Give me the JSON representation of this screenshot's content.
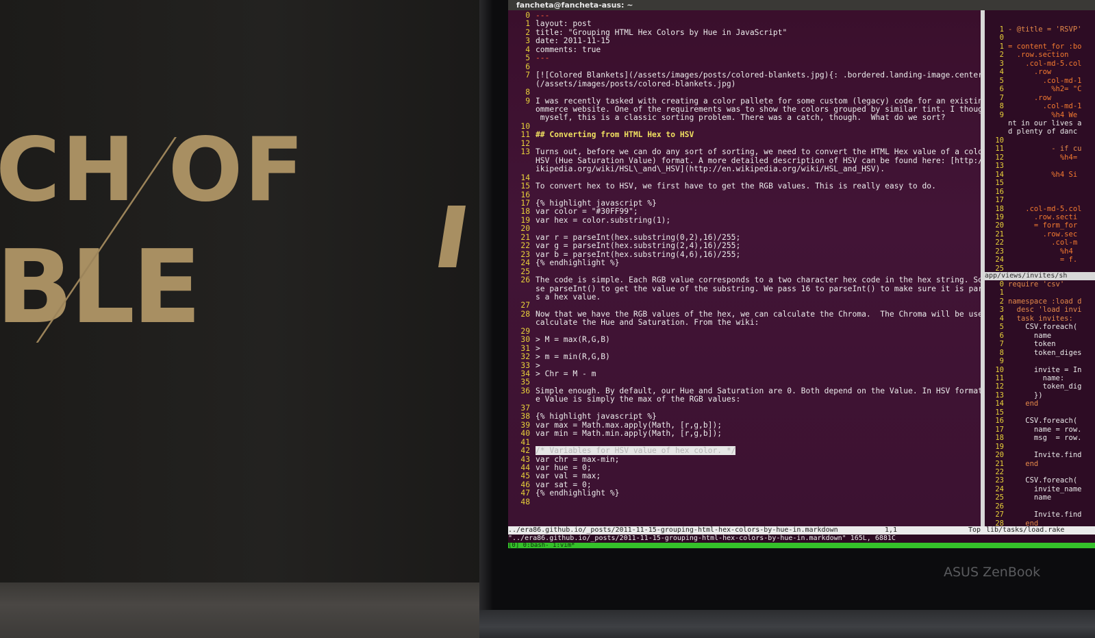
{
  "background": {
    "box_line1": "CH OF",
    "box_line2": "BLE",
    "laptop_brand": "ASUS ZenBook"
  },
  "colors": {
    "terminal_bg": "#3a0f2c",
    "line_number": "#e8d23a",
    "tmux_bar": "#35c02a",
    "heading": "#f0e060",
    "link": "#9d8cff"
  },
  "terminal": {
    "title": "fancheta@fancheta-asus: ~",
    "editor_lines": [
      {
        "n": "0",
        "t": "---"
      },
      {
        "n": "1",
        "t": "layout: post"
      },
      {
        "n": "2",
        "t": "title: \"Grouping HTML Hex Colors by Hue in JavaScript\""
      },
      {
        "n": "3",
        "t": "date: 2011-11-15"
      },
      {
        "n": "4",
        "t": "comments: true"
      },
      {
        "n": "5",
        "t": "---"
      },
      {
        "n": "6",
        "t": ""
      },
      {
        "n": "7",
        "t": "[![Colored Blankets](/assets/images/posts/colored-blankets.jpg){: .bordered.landing-image.centered }]"
      },
      {
        "n": "",
        "t": "(/assets/images/posts/colored-blankets.jpg)"
      },
      {
        "n": "8",
        "t": ""
      },
      {
        "n": "9",
        "t": "I was recently tasked with creating a color pallete for some custom (legacy) code for an existing e-c"
      },
      {
        "n": "",
        "t": "ommerce website. One of the requirements was to show the colors grouped by similar tint. I thought to"
      },
      {
        "n": "",
        "t": " myself, this is a classic sorting problem. There was a catch, though.  What do we sort?"
      },
      {
        "n": "10",
        "t": ""
      },
      {
        "n": "11",
        "t": "## Converting from HTML Hex to HSV"
      },
      {
        "n": "12",
        "t": ""
      },
      {
        "n": "13",
        "t": "Turns out, before we can do any sort of sorting, we need to convert the HTML Hex value of a color to"
      },
      {
        "n": "",
        "t": "HSV (Hue Saturation Value) format. A more detailed description of HSV can be found here: [http://en.w"
      },
      {
        "n": "",
        "t": "ikipedia.org/wiki/HSL\\_and\\_HSV](http://en.wikipedia.org/wiki/HSL_and_HSV)."
      },
      {
        "n": "14",
        "t": ""
      },
      {
        "n": "15",
        "t": "To convert hex to HSV, we first have to get the RGB values. This is really easy to do."
      },
      {
        "n": "16",
        "t": ""
      },
      {
        "n": "17",
        "t": "{% highlight javascript %}"
      },
      {
        "n": "18",
        "t": "var color = \"#30FF99\";"
      },
      {
        "n": "19",
        "t": "var hex = color.substring(1);"
      },
      {
        "n": "20",
        "t": ""
      },
      {
        "n": "21",
        "t": "var r = parseInt(hex.substring(0,2),16)/255;"
      },
      {
        "n": "22",
        "t": "var g = parseInt(hex.substring(2,4),16)/255;"
      },
      {
        "n": "23",
        "t": "var b = parseInt(hex.substring(4,6),16)/255;"
      },
      {
        "n": "24",
        "t": "{% endhighlight %}"
      },
      {
        "n": "25",
        "t": ""
      },
      {
        "n": "26",
        "t": "The code is simple. Each RGB value corresponds to a two character hex code in the hex string. So we u"
      },
      {
        "n": "",
        "t": "se parseInt() to get the value of the substring. We pass 16 to parseInt() to make sure it is parsed a"
      },
      {
        "n": "",
        "t": "s a hex value."
      },
      {
        "n": "27",
        "t": ""
      },
      {
        "n": "28",
        "t": "Now that we have the RGB values of the hex, we can calculate the Chroma.  The Chroma will be used to"
      },
      {
        "n": "",
        "t": "calculate the Hue and Saturation. From the wiki:"
      },
      {
        "n": "29",
        "t": ""
      },
      {
        "n": "30",
        "t": "> M = max(R,G,B)"
      },
      {
        "n": "31",
        "t": ">"
      },
      {
        "n": "32",
        "t": "> m = min(R,G,B)"
      },
      {
        "n": "33",
        "t": ">"
      },
      {
        "n": "34",
        "t": "> Chr = M - m"
      },
      {
        "n": "35",
        "t": ""
      },
      {
        "n": "36",
        "t": "Simple enough. By default, our Hue and Saturation are 0. Both depend on the Value. In HSV format, th"
      },
      {
        "n": "",
        "t": "e Value is simply the max of the RGB values:"
      },
      {
        "n": "37",
        "t": ""
      },
      {
        "n": "38",
        "t": "{% highlight javascript %}"
      },
      {
        "n": "39",
        "t": "var max = Math.max.apply(Math, [r,g,b]);"
      },
      {
        "n": "40",
        "t": "var min = Math.min.apply(Math, [r,g,b]);"
      },
      {
        "n": "41",
        "t": ""
      },
      {
        "n": "42",
        "t": "/* Variables for HSV value of hex color. */"
      },
      {
        "n": "43",
        "t": "var chr = max-min;"
      },
      {
        "n": "44",
        "t": "var hue = 0;"
      },
      {
        "n": "45",
        "t": "var val = max;"
      },
      {
        "n": "46",
        "t": "var sat = 0;"
      },
      {
        "n": "47",
        "t": "{% endhighlight %}"
      },
      {
        "n": "48",
        "t": ""
      }
    ],
    "right_lines": [
      {
        "n": "1",
        "t": "- @title = 'RSVP'"
      },
      {
        "n": "0",
        "t": ""
      },
      {
        "n": "1",
        "t": "= content_for :bo"
      },
      {
        "n": "2",
        "t": "  .row.section"
      },
      {
        "n": "3",
        "t": "    .col-md-5.col"
      },
      {
        "n": "4",
        "t": "      .row"
      },
      {
        "n": "5",
        "t": "        .col-md-1"
      },
      {
        "n": "6",
        "t": "          %h2= \"C"
      },
      {
        "n": "7",
        "t": "      .row"
      },
      {
        "n": "8",
        "t": "        .col-md-1"
      },
      {
        "n": "9",
        "t": "          %h4 We"
      },
      {
        "n": "",
        "t": "nt in our lives a"
      },
      {
        "n": "",
        "t": "d plenty of danc"
      },
      {
        "n": "10",
        "t": ""
      },
      {
        "n": "11",
        "t": "          - if cu"
      },
      {
        "n": "12",
        "t": "            %h4="
      },
      {
        "n": "13",
        "t": ""
      },
      {
        "n": "14",
        "t": "          %h4 Si"
      },
      {
        "n": "15",
        "t": ""
      },
      {
        "n": "16",
        "t": ""
      },
      {
        "n": "17",
        "t": ""
      },
      {
        "n": "18",
        "t": "    .col-md-5.col"
      },
      {
        "n": "19",
        "t": "      .row.secti"
      },
      {
        "n": "20",
        "t": "      = form_for"
      },
      {
        "n": "21",
        "t": "        .row.sec"
      },
      {
        "n": "22",
        "t": "          .col-m"
      },
      {
        "n": "23",
        "t": "            %h4"
      },
      {
        "n": "24",
        "t": "            = f."
      },
      {
        "n": "25",
        "t": ""
      }
    ],
    "right_status": "app/views/invites/sh",
    "right_lines2": [
      {
        "n": "0",
        "t": "require 'csv'"
      },
      {
        "n": "1",
        "t": ""
      },
      {
        "n": "2",
        "t": "namespace :load d"
      },
      {
        "n": "3",
        "t": "  desc 'load invi"
      },
      {
        "n": "4",
        "t": "  task invites:"
      },
      {
        "n": "5",
        "t": "    CSV.foreach("
      },
      {
        "n": "6",
        "t": "      name"
      },
      {
        "n": "7",
        "t": "      token"
      },
      {
        "n": "8",
        "t": "      token_diges"
      },
      {
        "n": "9",
        "t": ""
      },
      {
        "n": "10",
        "t": "      invite = In"
      },
      {
        "n": "11",
        "t": "        name:"
      },
      {
        "n": "12",
        "t": "        token_dig"
      },
      {
        "n": "13",
        "t": "      })"
      },
      {
        "n": "14",
        "t": "    end"
      },
      {
        "n": "15",
        "t": ""
      },
      {
        "n": "16",
        "t": "    CSV.foreach("
      },
      {
        "n": "17",
        "t": "      name = row."
      },
      {
        "n": "18",
        "t": "      msg  = row."
      },
      {
        "n": "19",
        "t": ""
      },
      {
        "n": "20",
        "t": "      Invite.find"
      },
      {
        "n": "21",
        "t": "    end"
      },
      {
        "n": "22",
        "t": ""
      },
      {
        "n": "23",
        "t": "    CSV.foreach("
      },
      {
        "n": "24",
        "t": "      invite_name"
      },
      {
        "n": "25",
        "t": "      name"
      },
      {
        "n": "26",
        "t": ""
      },
      {
        "n": "27",
        "t": "      Invite.find"
      },
      {
        "n": "28",
        "t": "    end"
      }
    ],
    "status_file": "../era86.github.io/_posts/2011-11-15-grouping-html-hex-colors-by-hue-in.markdown",
    "status_pos": "1,1",
    "status_top": "Top",
    "status_right": "lib/tasks/load.rake",
    "cmdline": "\"../era86.github.io/_posts/2011-11-15-grouping-html-hex-colors-by-hue-in.markdown\" 165L, 6881C",
    "tmux": "[0] 0:bash- 1:vim*"
  }
}
